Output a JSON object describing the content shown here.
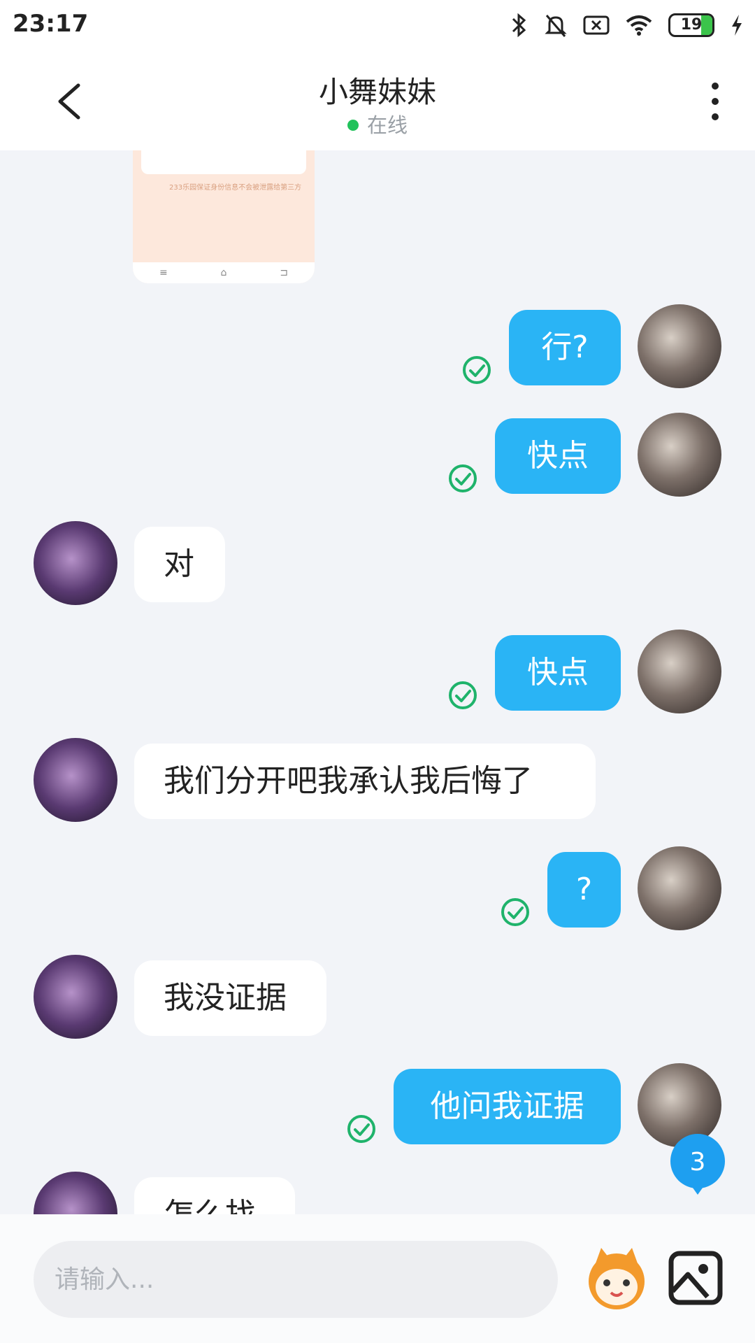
{
  "status_bar": {
    "time": "23:17",
    "battery": "19"
  },
  "header": {
    "title": "小舞妹妹",
    "status": "在线"
  },
  "preview": {
    "caption": "233乐园保证身份信息不会被泄露给第三方"
  },
  "messages": [
    {
      "side": "out",
      "text": "行?"
    },
    {
      "side": "out",
      "text": "快点"
    },
    {
      "side": "in",
      "text": "对"
    },
    {
      "side": "out",
      "text": "快点"
    },
    {
      "side": "in",
      "text": "我们分开吧我承认我后悔了"
    },
    {
      "side": "out",
      "text": "?"
    },
    {
      "side": "in",
      "text": "我没证据"
    },
    {
      "side": "out",
      "text": "他问我证据"
    },
    {
      "side": "in",
      "text": "怎么找"
    }
  ],
  "unread_badge": "3",
  "composer": {
    "placeholder": "请输入..."
  },
  "colors": {
    "out_bubble": "#2ab4f5",
    "online_dot": "#21c25b",
    "tick": "#1fb36b"
  },
  "icons": [
    "back-arrow-icon",
    "more-vertical-icon",
    "check-circle-icon",
    "emoji-mascot-icon",
    "image-icon",
    "bluetooth-icon",
    "mute-bell-icon",
    "sim-x-icon",
    "wifi-icon",
    "battery-icon",
    "charging-icon"
  ]
}
